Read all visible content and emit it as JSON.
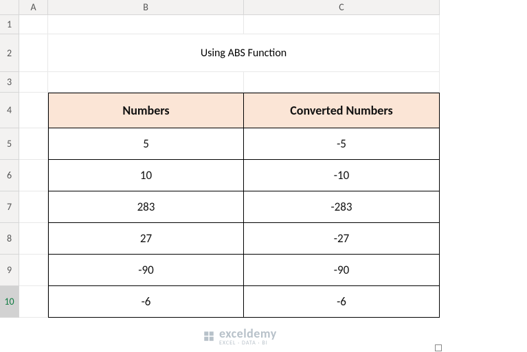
{
  "columns": [
    "A",
    "B",
    "C"
  ],
  "rows": [
    "1",
    "2",
    "3",
    "4",
    "5",
    "6",
    "7",
    "8",
    "9",
    "10"
  ],
  "selectedRow": "10",
  "title": "Using ABS Function",
  "headers": {
    "col1": "Numbers",
    "col2": "Converted Numbers"
  },
  "chart_data": {
    "type": "table",
    "title": "Using ABS Function",
    "columns": [
      "Numbers",
      "Converted Numbers"
    ],
    "rows": [
      {
        "numbers": "5",
        "converted": "-5"
      },
      {
        "numbers": "10",
        "converted": "-10"
      },
      {
        "numbers": "283",
        "converted": "-283"
      },
      {
        "numbers": "27",
        "converted": "-27"
      },
      {
        "numbers": "-90",
        "converted": "-90"
      },
      {
        "numbers": "-6",
        "converted": "-6"
      }
    ]
  },
  "watermark": {
    "brand": "exceldemy",
    "sub": "EXCEL · DATA · BI"
  }
}
